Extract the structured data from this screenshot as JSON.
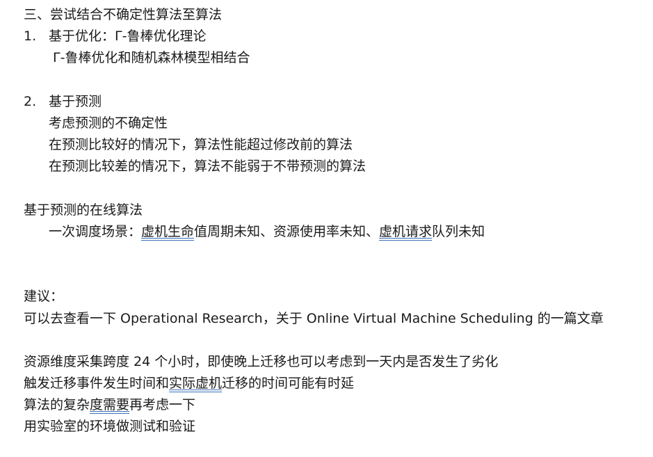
{
  "section_heading": "三、尝试结合不确定性算法至算法",
  "item1": {
    "number": "1.",
    "title": "基于优化：Γ-鲁棒优化理论",
    "sub": "Γ-鲁棒优化和随机森林模型相结合"
  },
  "item2": {
    "number": "2.",
    "title": "基于预测",
    "lines": [
      "考虑预测的不确定性",
      "在预测比较好的情况下，算法性能超过修改前的算法",
      "在预测比较差的情况下，算法不能弱于不带预测的算法"
    ]
  },
  "online": {
    "title": "基于预测的在线算法",
    "scene_prefix": "一次调度场景：",
    "scene_u1": "虚机生命",
    "scene_mid": "值周期未知、资源使用率未知、",
    "scene_u2": "虚机请求",
    "scene_suffix": "队列未知"
  },
  "advice": {
    "title": "建议：",
    "line": "可以去查看一下 Operational Research，关于 Online Virtual Machine Scheduling 的一篇文章"
  },
  "notes": {
    "n1": "资源维度采集跨度 24 个小时，即使晚上迁移也可以考虑到一天内是否发生了劣化",
    "n2_a": "触发迁移事件发生时间和",
    "n2_u": "实际虚机",
    "n2_b": "迁移的时间可能有时延",
    "n3_a": "算法的复杂",
    "n3_u": "度需要",
    "n3_b": "再考虑一下",
    "n4": "用实验室的环境做测试和验证"
  }
}
